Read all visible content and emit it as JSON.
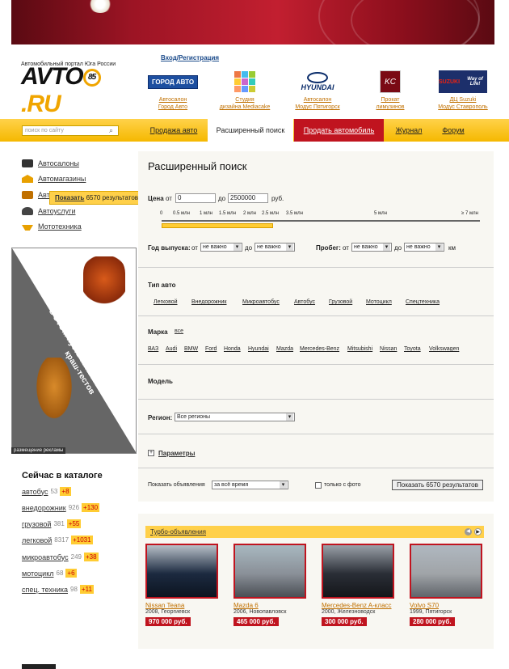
{
  "header": {
    "login": "Вход/Регистрация",
    "logo_text_a": "AVTO",
    "logo_text_b": ".RU",
    "logo_sub": "Автомобильный портал Юга России",
    "logo_mark": "85"
  },
  "partners": [
    {
      "logo": "ГОРОД АВТО",
      "l1": "Автосалон",
      "l2": "Город Авто"
    },
    {
      "logo": "MEDIACAKE",
      "l1": "Студия",
      "l2": "дизайна Mediacake"
    },
    {
      "logo": "HYUNDAI",
      "l1": "Автосалон",
      "l2": "Модус Пятигорск"
    },
    {
      "logo": "KC",
      "l1": "Прокат",
      "l2": "лимузинов"
    },
    {
      "logo": "SUZUKI",
      "l1": "ДЦ Suzuki",
      "l2": "Модус Ставрополь"
    }
  ],
  "nav": {
    "search_placeholder": "поиск по сайту",
    "items": [
      "Продажа авто",
      "Расширенный поиск",
      "Продать автомобиль",
      "Журнал",
      "Форум"
    ]
  },
  "sidebar": {
    "items": [
      "Автосалоны",
      "Автомагазины",
      "Авто",
      "Автоуслуги",
      "Мототехника"
    ]
  },
  "tooltip": {
    "link": "Показать",
    "text": "6570 результатов"
  },
  "ad": {
    "text": "в ЭТОМ пусть катаются манекены краш-тестов",
    "label": "размещение рекламы"
  },
  "catalog": {
    "title": "Сейчас в каталоге",
    "rows": [
      {
        "name": "автобус",
        "count": "53",
        "plus": "+8"
      },
      {
        "name": "внедорожник",
        "count": "926",
        "plus": "+130"
      },
      {
        "name": "грузовой",
        "count": "381",
        "plus": "+55"
      },
      {
        "name": "легковой",
        "count": "8317",
        "plus": "+1031"
      },
      {
        "name": "микроавтобус",
        "count": "249",
        "plus": "+38"
      },
      {
        "name": "мотоцикл",
        "count": "68",
        "plus": "+6"
      },
      {
        "name": "спец. техника",
        "count": "98",
        "plus": "+11"
      }
    ]
  },
  "search": {
    "title": "Расширенный поиск",
    "price_label": "Цена",
    "from": "от",
    "to": "до",
    "currency": "руб.",
    "price_from": "0",
    "price_to": "2500000",
    "scale": [
      "0",
      "0.5 млн",
      "1 млн",
      "1.5 млн",
      "2 млн",
      "2.5 млн",
      "3.5 млн",
      "5 млн",
      "≥ 7 млн"
    ],
    "year_label": "Год выпуска:",
    "year_from": "не важно",
    "year_to": "не важно",
    "mileage_label": "Пробег:",
    "mileage_from": "не важно",
    "mileage_to": "не важно",
    "km": "км",
    "type_label": "Тип авто",
    "types": [
      "Легковой",
      "Внедорожник",
      "Микроавтобус",
      "Автобус",
      "Грузовой",
      "Мотоцикл",
      "Спецтехника"
    ],
    "make_label": "Марка",
    "make_all": "все",
    "makes": [
      "ВАЗ",
      "Audi",
      "BMW",
      "Ford",
      "Honda",
      "Hyundai",
      "Mazda",
      "Mercedes-Benz",
      "Mitsubishi",
      "Nissan",
      "Toyota",
      "Volkswagen"
    ],
    "model_label": "Модель",
    "region_label": "Регион:",
    "region_value": "Все регионы",
    "params_label": "Параметры",
    "show_label": "Показать объявления",
    "period": "за всё время",
    "photo_only": "только с фото",
    "button": "Показать 6570 результатов"
  },
  "turbo": {
    "title": "Турбо-объявления",
    "cars": [
      {
        "name": "Nissan Teana",
        "desc": "2008, Георгиевск",
        "price": "970 000 руб."
      },
      {
        "name": "Mazda 6",
        "desc": "2006, Новопавловск",
        "price": "465 000 руб."
      },
      {
        "name": "Mercedes-Benz A-класс",
        "desc": "2000, Железноводск",
        "price": "300 000 руб."
      },
      {
        "name": "Volvo S70",
        "desc": "1999, Пятигорск",
        "price": "280 000 руб."
      }
    ]
  }
}
